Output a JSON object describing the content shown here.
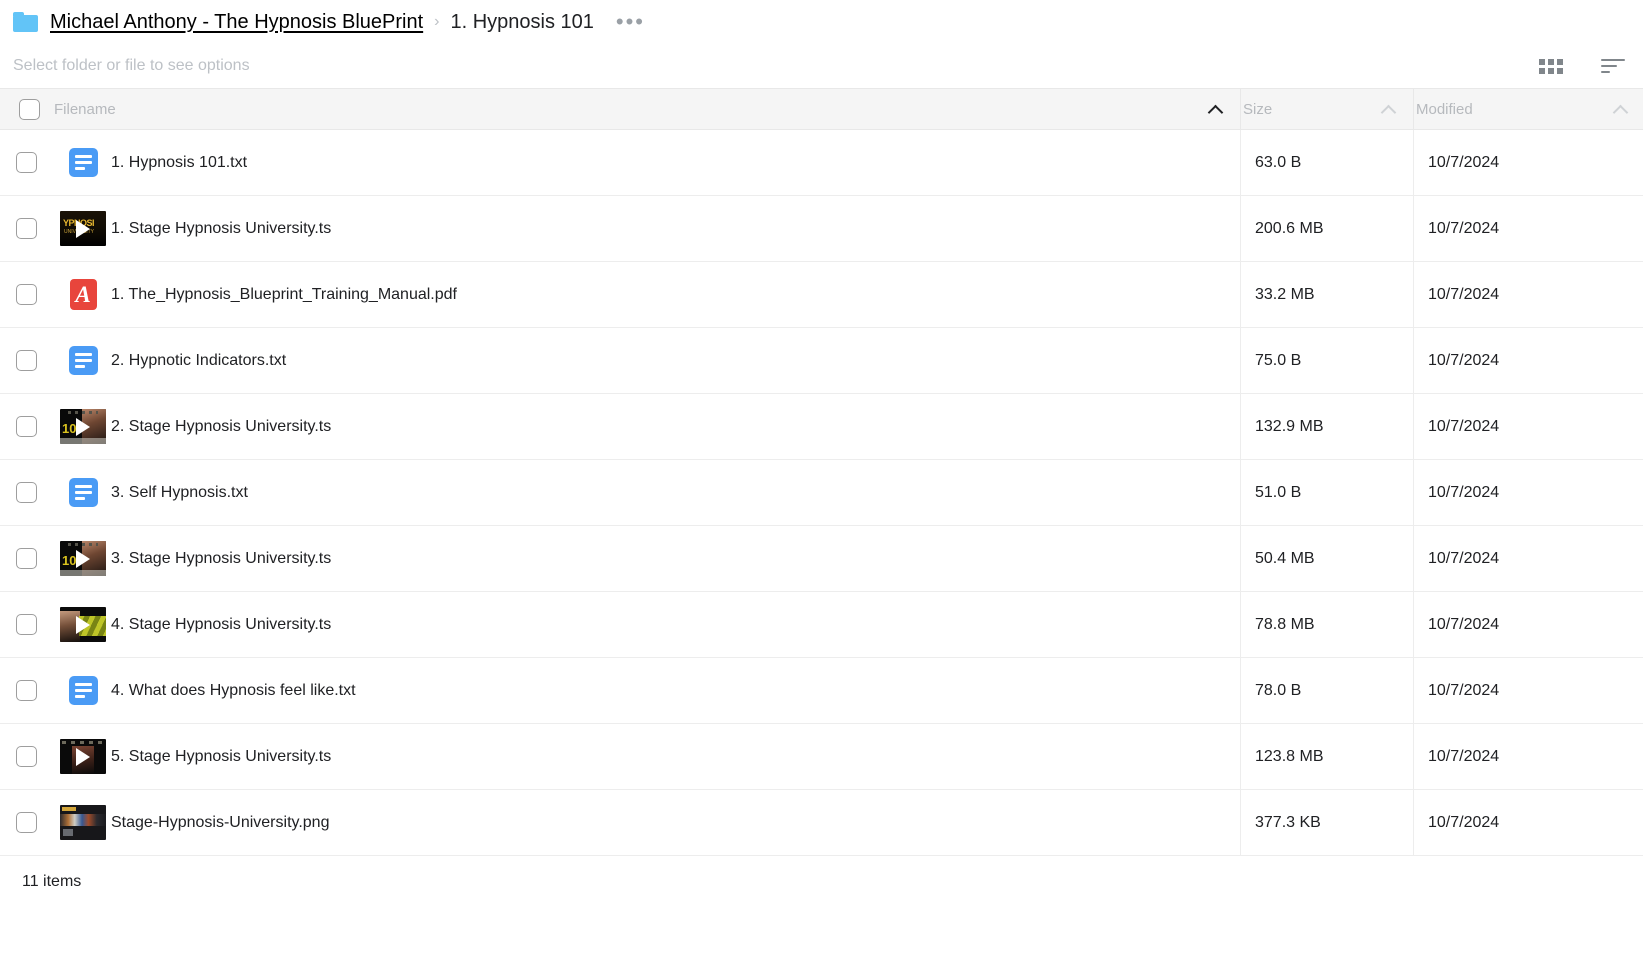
{
  "breadcrumb": {
    "folder_icon": "folder-icon",
    "root_label": "Michael Anthony - The Hypnosis BluePrint",
    "separator": "›",
    "current_label": "1. Hypnosis 101",
    "more_label": "•••"
  },
  "options_bar": {
    "hint": "Select folder or file to see options",
    "grid_view_icon": "grid-view-icon",
    "sort_icon": "sort-icon"
  },
  "table": {
    "columns": {
      "filename": "Filename",
      "size": "Size",
      "modified": "Modified"
    },
    "sort": {
      "active_column": "filename",
      "direction": "asc"
    },
    "rows": [
      {
        "name": "1. Hypnosis 101.txt",
        "size": "63.0 B",
        "modified": "10/7/2024",
        "icon": "text-file-icon",
        "kind": "txt"
      },
      {
        "name": "1. Stage Hypnosis University.ts",
        "size": "200.6 MB",
        "modified": "10/7/2024",
        "icon": "video-thumbnail",
        "kind": "video",
        "variant": "v1",
        "thumb_text": "YPNOSI",
        "thumb_subtext": "UNIVERSITY"
      },
      {
        "name": "1. The_Hypnosis_Blueprint_Training_Manual.pdf",
        "size": "33.2 MB",
        "modified": "10/7/2024",
        "icon": "pdf-file-icon",
        "kind": "pdf",
        "glyph": "A"
      },
      {
        "name": "2. Hypnotic Indicators.txt",
        "size": "75.0 B",
        "modified": "10/7/2024",
        "icon": "text-file-icon",
        "kind": "txt"
      },
      {
        "name": "2. Stage Hypnosis University.ts",
        "size": "132.9 MB",
        "modified": "10/7/2024",
        "icon": "video-thumbnail",
        "kind": "video",
        "variant": "v2",
        "thumb_text": "10"
      },
      {
        "name": "3. Self Hypnosis.txt",
        "size": "51.0 B",
        "modified": "10/7/2024",
        "icon": "text-file-icon",
        "kind": "txt"
      },
      {
        "name": "3. Stage Hypnosis University.ts",
        "size": "50.4 MB",
        "modified": "10/7/2024",
        "icon": "video-thumbnail",
        "kind": "video",
        "variant": "v2",
        "thumb_text": "10"
      },
      {
        "name": "4. Stage Hypnosis University.ts",
        "size": "78.8 MB",
        "modified": "10/7/2024",
        "icon": "video-thumbnail",
        "kind": "video",
        "variant": "v3",
        "thumb_text": ""
      },
      {
        "name": "4. What does Hypnosis feel like.txt",
        "size": "78.0 B",
        "modified": "10/7/2024",
        "icon": "text-file-icon",
        "kind": "txt"
      },
      {
        "name": "5. Stage Hypnosis University.ts",
        "size": "123.8 MB",
        "modified": "10/7/2024",
        "icon": "video-thumbnail",
        "kind": "video",
        "variant": "v4",
        "thumb_text": ""
      },
      {
        "name": "Stage-Hypnosis-University.png",
        "size": "377.3 KB",
        "modified": "10/7/2024",
        "icon": "image-thumbnail",
        "kind": "image"
      }
    ]
  },
  "footer": {
    "item_count_label": "11 items"
  },
  "colors": {
    "folder_blue": "#62c4f7",
    "txt_icon_blue": "#4a9bf5",
    "pdf_icon_red": "#e8453c",
    "header_bg": "#f5f5f5",
    "muted_text": "#b6b9bd"
  }
}
